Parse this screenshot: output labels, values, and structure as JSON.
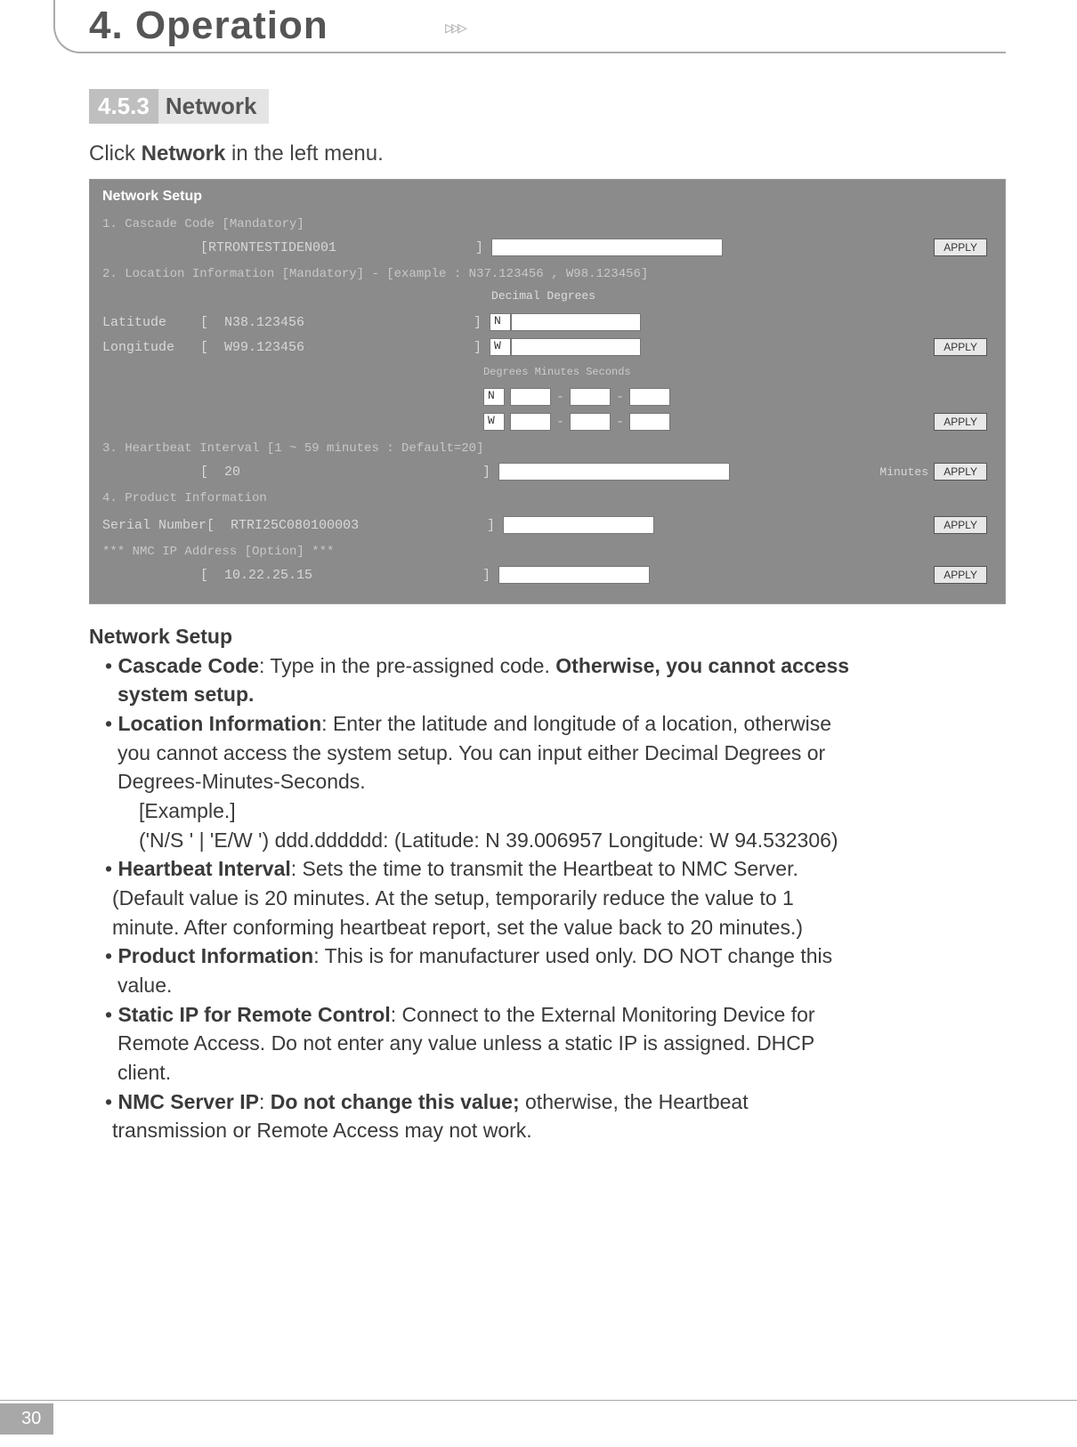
{
  "chapter": "4. Operation",
  "section_num": "4.5.3",
  "section_title": "Network",
  "intro_pre": "Click ",
  "intro_bold": "Network",
  "intro_post": " in the left menu.",
  "ss": {
    "title": "Network Setup",
    "row1_label": "1. Cascade Code [Mandatory]",
    "row1_val": "RTRONTESTIDEN001",
    "row2_label": "2. Location Information [Mandatory] - [example : N37.123456 , W98.123456]",
    "dec_deg": "Decimal Degrees",
    "lat_label": "Latitude",
    "lat_val": "N38.123456",
    "lat_nw": "N",
    "lon_label": "Longitude",
    "lon_val": "W99.123456",
    "lon_nw": "W",
    "dms_label": "Degrees   Minutes   Seconds",
    "dms_n": "N",
    "dms_w": "W",
    "row3_label": "3. Heartbeat Interval [1 ~ 59 minutes : Default=20]",
    "row3_val": "20",
    "row3_unit": "Minutes",
    "row4_label": "4. Product Information",
    "serial_label": "Serial Number",
    "serial_val": "RTRI25C080100003",
    "nmc_label": "*** NMC IP Address [Option] ***",
    "nmc_val": "10.22.25.15",
    "apply": "APPLY"
  },
  "notes": {
    "title": "Network Setup",
    "l1a": "• ",
    "l1b": "Cascade Code",
    "l1c": ": Type in the  pre-assigned code. ",
    "l1d": "Otherwise, you cannot access",
    "l1e": "system setup.",
    "l2a": "• ",
    "l2b": "Location Information",
    "l2c": ": Enter the latitude and longitude of a location, otherwise",
    "l2d": "you cannot access the system setup. You can input either Decimal Degrees or",
    "l2e": "Degrees-Minutes-Seconds.",
    "l2f": "[Example.]",
    "l2g": "('N/S ' | 'E/W ') ddd.dddddd: (Latitude: N 39.006957 Longitude: W 94.532306)",
    "l3a": "• ",
    "l3b": "Heartbeat Interval",
    "l3c": ": Sets the time to transmit the Heartbeat to NMC Server.",
    "l3d": "(Default value is 20 minutes. At the setup, temporarily reduce the value to 1",
    "l3e": "minute. After conforming heartbeat report, set the value back to 20 minutes.)",
    "l4a": "• ",
    "l4b": "Product Information",
    "l4c": ": This is for manufacturer used only. DO NOT change this",
    "l4d": "value.",
    "l5a": "• ",
    "l5b": "Static IP for Remote Control",
    "l5c": ": Connect to the External Monitoring Device for",
    "l5d": "Remote Access. Do not enter any value unless a static IP is assigned. DHCP",
    "l5e": "client.",
    "l6a": "• ",
    "l6b": "NMC Server IP",
    "l6c": ": ",
    "l6d": "Do not change this value;",
    "l6e": " otherwise, the Heartbeat",
    "l6f": "transmission or Remote Access may not work."
  },
  "page_num": "30"
}
